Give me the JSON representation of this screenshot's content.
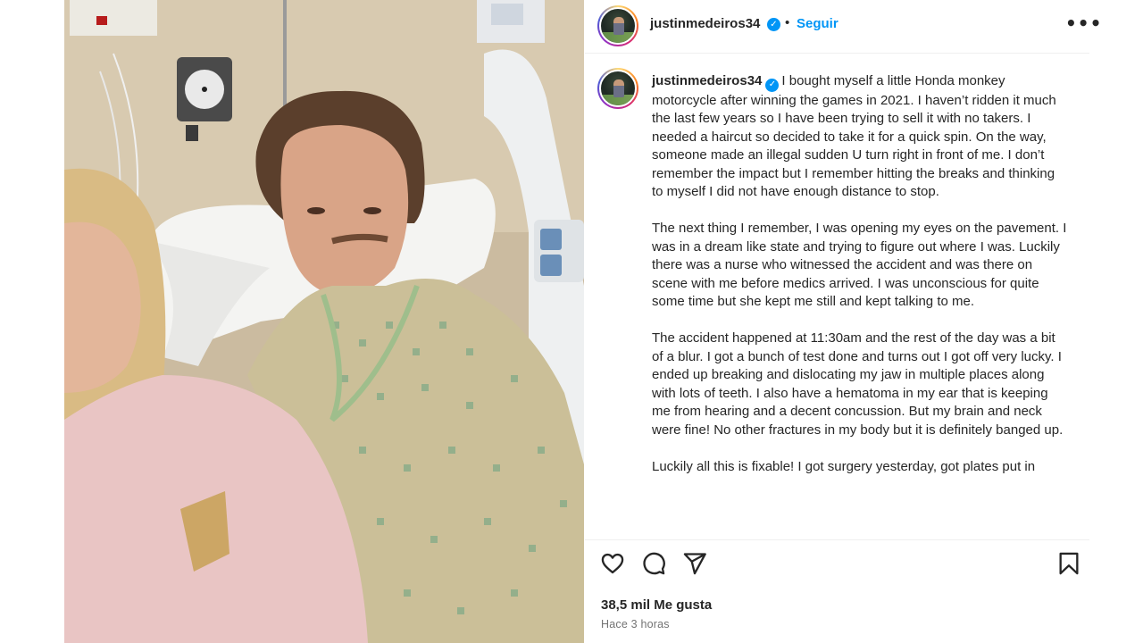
{
  "post": {
    "username": "justinmedeiros34",
    "follow_label": "Seguir",
    "separator": "•",
    "more_label": "•••",
    "verified_mark": "✓",
    "next_arrow": "›",
    "caption": {
      "username": "justinmedeiros34",
      "paragraphs": [
        "I bought myself a little Honda monkey motorcycle after winning the games in 2021. I haven’t ridden it much the last few years so I have been trying to sell it with no takers. I needed a haircut so decided to take it for a quick spin. On the way, someone made an illegal sudden U turn right in front of me. I don’t remember the impact but I remember hitting the breaks and thinking to myself I did not have enough distance to stop.",
        "The next thing I remember, I was opening my eyes on the pavement. I was in a dream like state and trying to figure out where I was. Luckily there was a nurse who witnessed the accident and was there on scene with me before medics arrived. I was unconscious for quite some time but she kept me still and kept talking to me.",
        "The accident happened at 11:30am and the rest of the day was a bit of a blur. I got a bunch of test done and turns out I got off very lucky. I ended up breaking and dislocating my jaw in multiple places along with lots of teeth. I also have a hematoma in my ear that is keeping me from hearing and a decent concussion. But my brain and neck were fine! No other fractures in my body but it is definitely banged up.",
        "Luckily all this is fixable! I got surgery yesterday, got plates put in"
      ]
    },
    "likes": "38,5 mil Me gusta",
    "time": "Hace 3 horas",
    "icons": {
      "like": "heart-icon",
      "comment": "comment-icon",
      "share": "share-icon",
      "save": "bookmark-icon",
      "verified": "verified-badge-icon",
      "more": "more-options-icon",
      "next": "chevron-right-icon"
    },
    "colors": {
      "accent": "#0095f6",
      "text": "#262626",
      "muted": "#737373"
    }
  }
}
